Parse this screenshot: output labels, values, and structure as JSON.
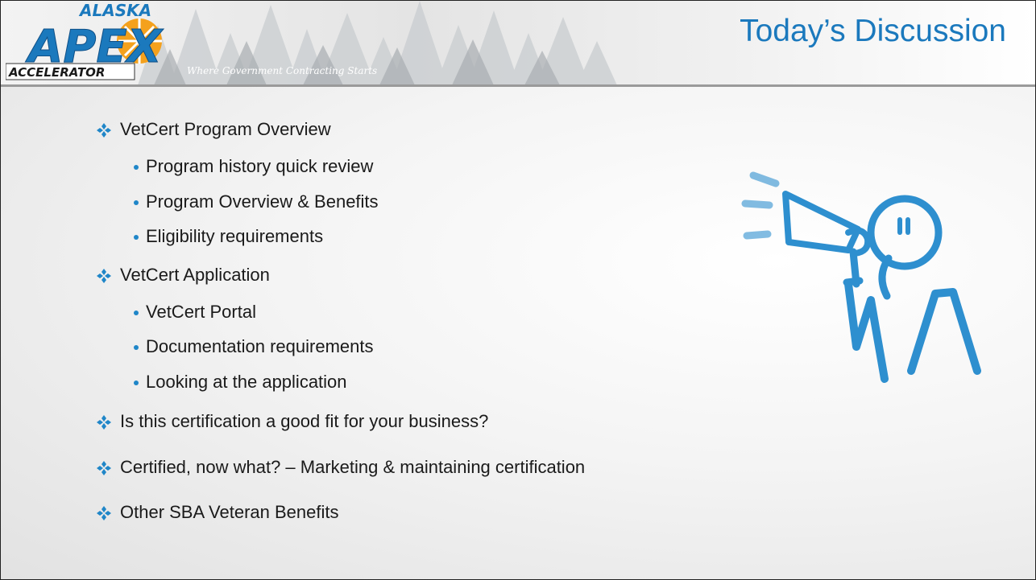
{
  "logo": {
    "top": "ALASKA",
    "main": "APEX",
    "bottom": "ACCELERATOR",
    "tagline": "Where Government Contracting Starts"
  },
  "slide": {
    "title": "Today’s Discussion"
  },
  "agenda": {
    "section1": {
      "label": "VetCert Program Overview",
      "items": [
        "Program history quick review",
        "Program Overview & Benefits",
        "Eligibility requirements"
      ]
    },
    "section2": {
      "label": "VetCert Application",
      "items": [
        "VetCert Portal",
        "Documentation requirements",
        "Looking at the application"
      ]
    },
    "section3": {
      "label": "Is this certification a good fit for your business?"
    },
    "section4": {
      "label": "Certified, now what? – Marketing & maintaining certification"
    },
    "section5": {
      "label": "Other SBA Veteran Benefits"
    }
  },
  "colors": {
    "accent": "#1b79bd",
    "bullet": "#1f86c8",
    "figure": "#2e8fcf",
    "logo_orange": "#f4a11d"
  },
  "icons": {
    "main_bullet": "four-diamond-bullet-icon",
    "sub_bullet": "dot-bullet-icon",
    "illustration": "megaphone-person-icon"
  }
}
